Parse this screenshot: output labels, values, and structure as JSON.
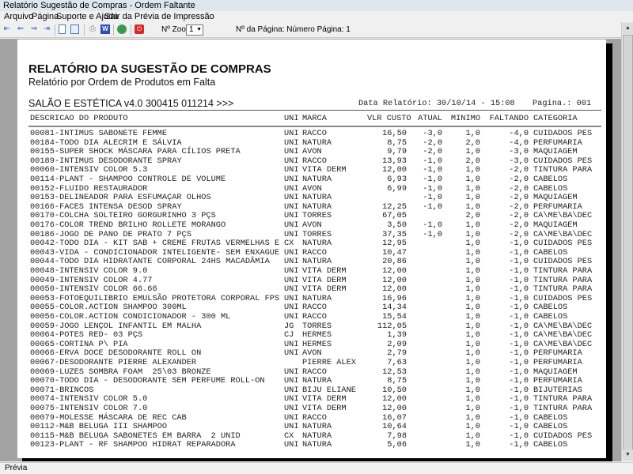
{
  "window": {
    "title": "Relatório Sugestão de Compras - Ordem Faltante"
  },
  "menu": [
    "Arquivo",
    "Página",
    "Suporte e Ajuda",
    "Sair da Prévia de Impressão"
  ],
  "toolbar": {
    "zoom_label": "Nº Zoom",
    "zoom_value": "1",
    "page_label": "Nº da Página: Número Página: 1",
    "icons": [
      "first-page-icon",
      "prev-page-icon",
      "next-page-icon",
      "last-page-icon",
      "single-page-icon",
      "two-page-icon",
      "print-icon",
      "word-export-icon",
      "web-export-icon",
      "close-icon"
    ]
  },
  "report": {
    "title": "RELATÓRIO DA SUGESTÃO DE COMPRAS",
    "subtitle": "Relatório por Ordem de Produtos em Falta",
    "company": "SALÃO E ESTÉTICA v4.0 300415 011214 >>>",
    "date": "Data Relatório: 30/10/14 - 15:08",
    "page": "Pagina.: 001",
    "columns": [
      "DESCRICAO DO PRODUTO",
      "UNI",
      "MARCA",
      "VLR CUSTO",
      "ATUAL",
      "MINIMO",
      "FALTANDO",
      "CATEGORIA"
    ],
    "rows": [
      [
        "00081-INTIMUS SABONETE FEMME",
        "UNI",
        "RACCO",
        "16,50",
        "-3,0",
        "1,0",
        "-4,0",
        "CUIDADOS PES"
      ],
      [
        "00184-TODO DIA ALECRIM E SÁLVIA",
        "UNI",
        "NATURA",
        "8,75",
        "-2,0",
        "2,0",
        "-4,0",
        "PERFUMARIA"
      ],
      [
        "00155-SUPER SHOCK MÁSCARA PARA CÍLIOS PRETA",
        "UNI",
        "AVON",
        "9,79",
        "-2,0",
        "1,0",
        "-3,0",
        "MAQUIAGEM"
      ],
      [
        "00189-INTIMUS DESODORANTE SPRAY",
        "UNI",
        "RACCO",
        "13,93",
        "-1,0",
        "2,0",
        "-3,0",
        "CUIDADOS PES"
      ],
      [
        "00060-INTENSIV COLOR 5.3",
        "UNI",
        "VITA DERM",
        "12,00",
        "-1,0",
        "1,0",
        "-2,0",
        "TINTURA PARA"
      ],
      [
        "00114-PLANT - SHAMPOO CONTROLE DE VOLUME",
        "UNI",
        "NATURA",
        "6,93",
        "-1,0",
        "1,0",
        "-2,0",
        "CABELOS"
      ],
      [
        "00152-FLUIDO RESTAURADOR",
        "UNI",
        "AVON",
        "6,99",
        "-1,0",
        "1,0",
        "-2,0",
        "CABELOS"
      ],
      [
        "00153-DELINEADOR PARA ESFUMAÇAR OLHOS",
        "UNI",
        "NATURA",
        "",
        "-1,0",
        "1,0",
        "-2,0",
        "MAQUIAGEM"
      ],
      [
        "00166-FACES INTENSA DESOD SPRAY",
        "UNI",
        "NATURA",
        "12,25",
        "-1,0",
        "1,0",
        "-2,0",
        "PERFUMARIA"
      ],
      [
        "00170-COLCHA SOLTEIRO GORGURINHO 3 PÇS",
        "UNI",
        "TORRES",
        "67,05",
        "",
        "2,0",
        "-2,0",
        "CA\\ME\\BA\\DEC"
      ],
      [
        "00176-COLOR TREND BRILHO ROLLETE MORANGO",
        "UNI",
        "AVON",
        "3,50",
        "-1,0",
        "1,0",
        "-2,0",
        "MAQUIAGEM"
      ],
      [
        "00186-JOGO DE PANO DE PRATO 7 PÇS",
        "UNI",
        "TORRES",
        "37,35",
        "-1,0",
        "1,0",
        "-2,0",
        "CA\\ME\\BA\\DEC"
      ],
      [
        "00042-TODO DIA - KIT SAB + CREME FRUTAS VERMELHAS E",
        "CX",
        "NATURA",
        "12,95",
        "",
        "1,0",
        "-1,0",
        "CUIDADOS PES"
      ],
      [
        "00043-VIDA - CONDICIONADOR INTELIGENTE- SEM ENXAGUE",
        "UNI",
        "RACCO",
        "10,47",
        "",
        "1,0",
        "-1,0",
        "CABELOS"
      ],
      [
        "00044-TODO DIA HIDRATANTE CORPORAL 24HS MACADÂMIA",
        "UNI",
        "NATURA",
        "20,86",
        "",
        "1,0",
        "-1,0",
        "CUIDADOS PES"
      ],
      [
        "00048-INTENSIV COLOR 9.0",
        "UNI",
        "VITA DERM",
        "12,00",
        "",
        "1,0",
        "-1,0",
        "TINTURA PARA"
      ],
      [
        "00049-INTENSIV COLOR 4.77",
        "UNI",
        "VITA DERM",
        "12,00",
        "",
        "1,0",
        "-1,0",
        "TINTURA PARA"
      ],
      [
        "00050-INTENSIV COLOR 66.66",
        "UNI",
        "VITA DERM",
        "12,00",
        "",
        "1,0",
        "-1,0",
        "TINTURA PARA"
      ],
      [
        "00053-FOTOEQUILIBRIO EMULSÃO PROTETORA CORPORAL FPS",
        "UNI",
        "NATURA",
        "16,96",
        "",
        "1,0",
        "-1,0",
        "CUIDADOS PES"
      ],
      [
        "00055-COLOR.ACTION SHAMPOO 300ML",
        "UNI",
        "RACCO",
        "14,34",
        "",
        "1,0",
        "-1,0",
        "CABELOS"
      ],
      [
        "00056-COLOR.ACTION CONDICIONADOR - 300 ML",
        "UNI",
        "RACCO",
        "15,54",
        "",
        "1,0",
        "-1,0",
        "CABELOS"
      ],
      [
        "00059-JOGO LENÇOL INFANTIL EM MALHA",
        "JG",
        "TORRES",
        "112,05",
        "",
        "1,0",
        "-1,0",
        "CA\\ME\\BA\\DEC"
      ],
      [
        "00064-POTES RED- 03 PÇS",
        "CJ",
        "HERMES",
        "1,39",
        "",
        "1,0",
        "-1,0",
        "CA\\ME\\BA\\DEC"
      ],
      [
        "00065-CORTINA P\\ PIA",
        "UNI",
        "HERMES",
        "2,09",
        "",
        "1,0",
        "-1,0",
        "CA\\ME\\BA\\DEC"
      ],
      [
        "00066-ERVA DOCE DESODORANTE ROLL ON",
        "UNI",
        "AVON",
        "2,79",
        "",
        "1,0",
        "-1,0",
        "PERFUMARIA"
      ],
      [
        "00067-DESODORANTE PIERRE ALEXANDER",
        "",
        "PIERRE ALEX",
        "7,63",
        "",
        "1,0",
        "-1,0",
        "PERFUMARIA"
      ],
      [
        "00069-LUZES SOMBRA FOAM  25\\03 BRONZE",
        "UNI",
        "RACCO",
        "12,53",
        "",
        "1,0",
        "-1,0",
        "MAQUIAGEM"
      ],
      [
        "00070-TODO DIA - DESODORANTE SEM PERFUME ROLL-ON",
        "UNI",
        "NATURA",
        "8,75",
        "",
        "1,0",
        "-1,0",
        "PERFUMARIA"
      ],
      [
        "00071-BRINCOS",
        "UNI",
        "BIJU ELIANE",
        "10,50",
        "",
        "1,0",
        "-1,0",
        "BIJUTERIAS"
      ],
      [
        "00074-INTENSIV COLOR 5.0",
        "UNI",
        "VITA DERM",
        "12,00",
        "",
        "1,0",
        "-1,0",
        "TINTURA PARA"
      ],
      [
        "00075-INTENSIV COLOR 7.0",
        "UNI",
        "VITA DERM",
        "12,00",
        "",
        "1,0",
        "-1,0",
        "TINTURA PARA"
      ],
      [
        "00079-MOLESSE MÁSCARA DE REC CAB",
        "UNI",
        "RACCO",
        "16,07",
        "",
        "1,0",
        "-1,0",
        "CABELOS"
      ],
      [
        "00112-M&B BELUGA III SHAMPOO",
        "UNI",
        "NATURA",
        "10,64",
        "",
        "1,0",
        "-1,0",
        "CABELOS"
      ],
      [
        "00115-M&B BELUGA SABONETES EM BARRA  2 UNID",
        "CX",
        "NATURA",
        "7,98",
        "",
        "1,0",
        "-1,0",
        "CUIDADOS PES"
      ],
      [
        "00123-PLANT - RF SHAMPOO HIDRAT REPARADORA",
        "UNI",
        "NATURA",
        "5,06",
        "",
        "1,0",
        "-1,0",
        "CABELOS"
      ]
    ]
  },
  "status": {
    "text": "Prévia"
  }
}
